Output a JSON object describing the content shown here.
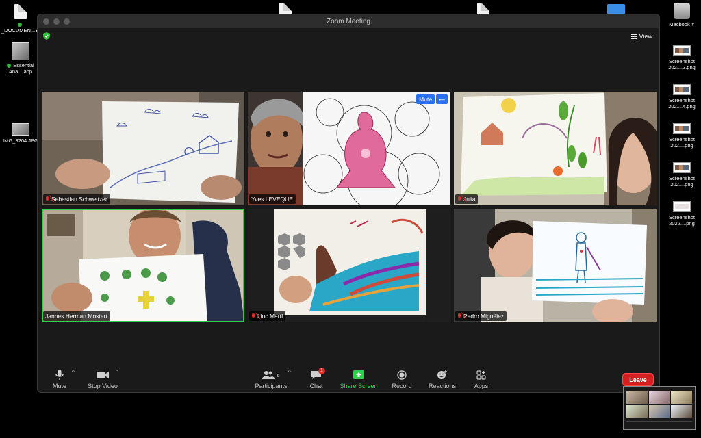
{
  "window": {
    "title": "Zoom Meeting"
  },
  "view": {
    "label": "View"
  },
  "desktop_left": [
    {
      "label": "_DOCUMEN...YLP",
      "status": "online",
      "icon": "document-file-icon"
    },
    {
      "label": "Essential Ana....app",
      "status": "online",
      "icon": "app-icon"
    },
    {
      "label": "IMG_3204.JPG",
      "icon": "image-file-icon"
    }
  ],
  "desktop_right": [
    {
      "label": "Macbook Y",
      "icon": "drive-icon"
    },
    {
      "label": "Screenshot 202....2.png",
      "icon": "screenshot-file-icon"
    },
    {
      "label": "Screenshot 202....4.png",
      "icon": "screenshot-file-icon"
    },
    {
      "label": "Screenshot 202....png",
      "icon": "screenshot-file-icon"
    },
    {
      "label": "Screenshot 202....png",
      "icon": "screenshot-file-icon"
    },
    {
      "label": "Screenshot 2022....png",
      "icon": "screenshot-file-icon"
    }
  ],
  "participants": [
    {
      "name": "Sebastian Schweitzer",
      "muted": true,
      "active": false
    },
    {
      "name": "Yves LEVEQUE",
      "muted": false,
      "active": false,
      "hover_mute": "Mute",
      "hover_more": "•••"
    },
    {
      "name": "Julia",
      "muted": true,
      "active": false
    },
    {
      "name": "Jannes Herman Mostert",
      "muted": false,
      "active": true
    },
    {
      "name": "Lluc Martí",
      "muted": true,
      "active": false
    },
    {
      "name": "Pedro Miguélez",
      "muted": true,
      "active": false
    }
  ],
  "toolbar": {
    "mute": "Mute",
    "stop_video": "Stop Video",
    "participants": "Participants",
    "participants_count": "6",
    "chat": "Chat",
    "chat_badge": "1",
    "share_screen": "Share Screen",
    "record": "Record",
    "reactions": "Reactions",
    "apps": "Apps",
    "caret": "^"
  },
  "leave": {
    "label": "Leave"
  },
  "colors": {
    "accent_green": "#2fd14a",
    "leave_red": "#d62020",
    "mute_blue": "#2a6ff0"
  }
}
